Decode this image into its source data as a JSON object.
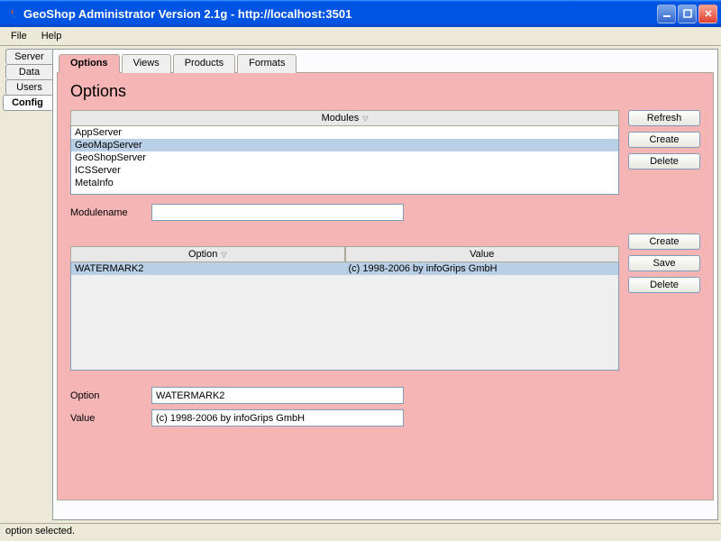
{
  "window": {
    "title": "GeoShop Administrator Version 2.1g - http://localhost:3501"
  },
  "menubar": {
    "file": "File",
    "help": "Help"
  },
  "side_tabs": {
    "items": [
      "Server",
      "Data",
      "Users",
      "Config"
    ],
    "selected": 3
  },
  "htabs": {
    "items": [
      "Options",
      "Views",
      "Products",
      "Formats"
    ],
    "selected": 0
  },
  "page_title": "Options",
  "modules": {
    "header": "Modules",
    "items": [
      "AppServer",
      "GeoMapServer",
      "GeoShopServer",
      "ICSServer",
      "MetaInfo"
    ],
    "selected": 1,
    "buttons": {
      "refresh": "Refresh",
      "create": "Create",
      "delete": "Delete"
    }
  },
  "modulename": {
    "label": "Modulename",
    "value": ""
  },
  "options_table": {
    "headers": {
      "option": "Option",
      "value": "Value"
    },
    "rows": [
      {
        "option": "WATERMARK2",
        "value": "(c) 1998-2006 by infoGrips GmbH"
      }
    ],
    "selected": 0,
    "buttons": {
      "create": "Create",
      "save": "Save",
      "delete": "Delete"
    }
  },
  "detail": {
    "option_label": "Option",
    "option_value": "WATERMARK2",
    "value_label": "Value",
    "value_value": "(c) 1998-2006 by infoGrips GmbH"
  },
  "statusbar": "option selected."
}
